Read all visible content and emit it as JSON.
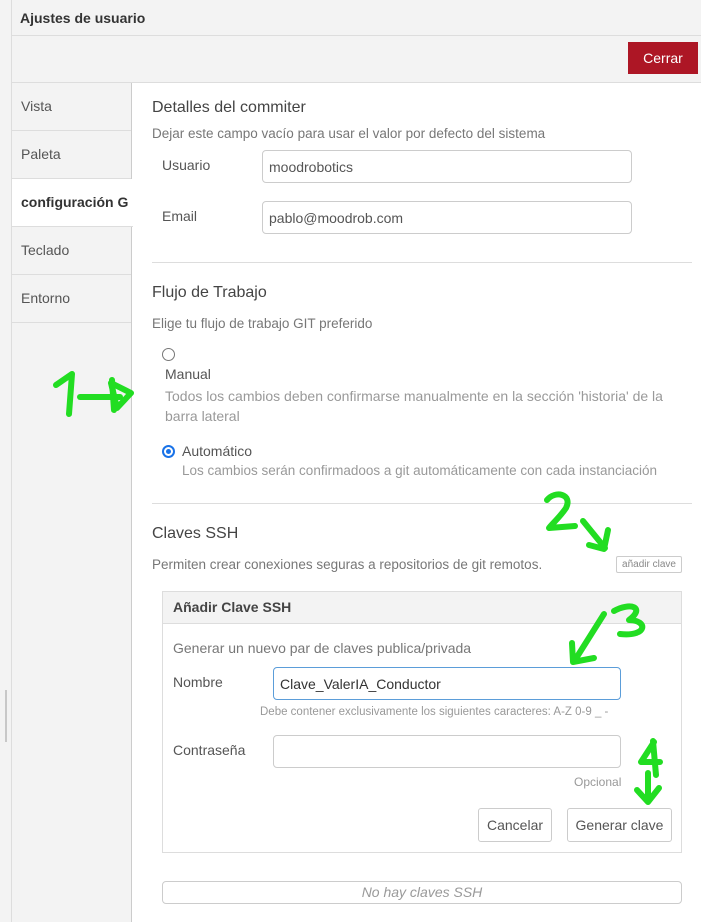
{
  "dialog": {
    "title": "Ajustes de usuario",
    "close_label": "Cerrar"
  },
  "sidebar": {
    "tabs": [
      {
        "label": "Vista"
      },
      {
        "label": "Paleta"
      },
      {
        "label": "configuración G"
      },
      {
        "label": "Teclado"
      },
      {
        "label": "Entorno"
      }
    ]
  },
  "committer": {
    "heading": "Detalles del commiter",
    "hint": "Dejar este campo vacío para usar el valor por defecto del sistema",
    "user_label": "Usuario",
    "user_value": "moodrobotics",
    "email_label": "Email",
    "email_value": "pablo@moodrob.com"
  },
  "workflow": {
    "heading": "Flujo de Trabajo",
    "hint": "Elige tu flujo de trabajo GIT preferido",
    "manual_label": "Manual",
    "manual_desc": "Todos los cambios deben confirmarse manualmente en la sección 'historia' de la barra lateral",
    "auto_label": "Automático",
    "auto_desc": "Los cambios serán confirmadoos a git automáticamente con cada instanciación",
    "selected": "Automático"
  },
  "ssh": {
    "heading": "Claves SSH",
    "hint": "Permiten crear conexiones seguras a repositorios de git remotos.",
    "add_key_label": "añadir clave",
    "panel_title": "Añadir Clave SSH",
    "panel_hint": "Generar un nuevo par de claves publica/privada",
    "name_label": "Nombre",
    "name_value": "Clave_ValerIA_Conductor",
    "name_help": "Debe contener exclusivamente los siguientes caracteres: A-Z 0-9 _ -",
    "password_label": "Contraseña",
    "password_value": "",
    "password_help": "Opcional",
    "cancel_label": "Cancelar",
    "generate_label": "Generar clave",
    "empty_label": "No hay claves SSH"
  },
  "annotations": {
    "color": "#22dd22",
    "numbers": [
      "1",
      "2",
      "3",
      "4"
    ]
  }
}
